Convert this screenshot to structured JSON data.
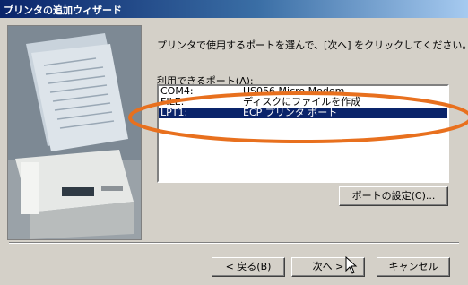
{
  "window": {
    "title": "プリンタの追加ウィザード"
  },
  "main": {
    "description": "プリンタで使用するポートを選んで、[次へ] をクリックしてください。",
    "ports_label": "利用できるポート(",
    "ports_label_accel": "A",
    "ports_label_end": "):",
    "ports": [
      {
        "port": "COM4:",
        "desc": "US056 Micro Modem",
        "selected": false
      },
      {
        "port": "FILE:",
        "desc": "ディスクにファイルを作成",
        "selected": false
      },
      {
        "port": "LPT1:",
        "desc": "ECP プリンタ ポート",
        "selected": true
      }
    ],
    "port_settings_button": "ポートの設定(C)..."
  },
  "footer": {
    "back_button": "< 戻る(B)",
    "next_button": "次へ >",
    "cancel_button": "キャンセル"
  },
  "colors": {
    "annotation_ellipse": "#e8701e",
    "selection": "#0a246a",
    "dialog_face": "#d4d0c8"
  }
}
